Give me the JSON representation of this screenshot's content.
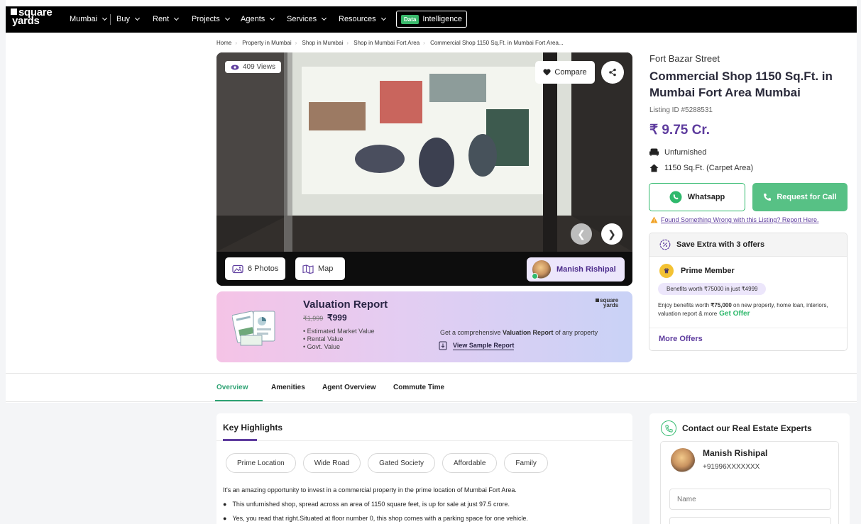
{
  "colors": {
    "brand": "#5e3c9e",
    "green": "#2fb96c",
    "accent_green": "#2fa374",
    "nav_bg": "#000000"
  },
  "nav": {
    "logo_line1": "square",
    "logo_line2": "yards",
    "items": [
      {
        "label": "Mumbai"
      },
      {
        "label": "Buy"
      },
      {
        "label": "Rent"
      },
      {
        "label": "Projects"
      },
      {
        "label": "Agents"
      },
      {
        "label": "Services"
      },
      {
        "label": "Resources"
      }
    ],
    "intel_badge": "Data",
    "intel_label": "Intelligence"
  },
  "breadcrumb": [
    "Home",
    "Property in Mumbai",
    "Shop in Mumbai",
    "Shop in Mumbai Fort Area",
    "Commercial Shop 1150 Sq.Ft. in Mumbai Fort Area..."
  ],
  "gallery": {
    "views": "409 Views",
    "compare": "Compare",
    "photos": "6 Photos",
    "map": "Map",
    "agent": "Manish Rishipal"
  },
  "valuation": {
    "title": "Valuation Report",
    "old_price": "₹1,999",
    "new_price": "₹999",
    "points": [
      "• Estimated Market Value",
      "• Rental Value",
      "• Govt. Value"
    ],
    "logo_line1": "square",
    "logo_line2": "yards",
    "desc_pre": "Get a comprehensive ",
    "desc_bold": "Valuation Report",
    "desc_post": " of any property",
    "sample": "View Sample Report"
  },
  "listing": {
    "location": "Fort Bazar Street",
    "title": "Commercial Shop 1150 Sq.Ft. in Mumbai Fort Area Mumbai",
    "id": "Listing ID #5288531",
    "price": "₹ 9.75 Cr.",
    "furnishing": "Unfurnished",
    "area": "1150 Sq.Ft. (Carpet Area)",
    "whatsapp": "Whatsapp",
    "request": "Request for Call",
    "report": "Found Something Wrong with this Listing? Report Here."
  },
  "offers": {
    "header": "Save Extra with 3 offers",
    "prime": "Prime Member",
    "benefit": "Benefits worth ₹75000 in just ₹4999",
    "enjoy_pre": "Enjoy benefits worth ",
    "enjoy_amt": "₹75,000",
    "enjoy_post": " on new property, home loan, interiors, valuation report & more",
    "get_offer": "Get Offer",
    "more": "More Offers"
  },
  "tabs": [
    "Overview",
    "Amenities",
    "Agent Overview",
    "Commute Time"
  ],
  "highlights": {
    "title": "Key Highlights",
    "tags": [
      "Prime Location",
      "Wide Road",
      "Gated Society",
      "Affordable",
      "Family"
    ],
    "para": "It's an amazing opportunity to invest in a commercial property in the prime location of Mumbai Fort Area.",
    "bullets": [
      "This unfurnished shop, spread across an area of 1150 square feet, is up for sale at just 97.5 crore.",
      "Yes, you read that right.Situated at floor number 0, this shop comes with a parking space for one vehicle."
    ]
  },
  "contact": {
    "title": "Contact our Real Estate Experts",
    "agent": "Manish Rishipal",
    "phone": "+91996XXXXXXX",
    "name_placeholder": "Name"
  }
}
